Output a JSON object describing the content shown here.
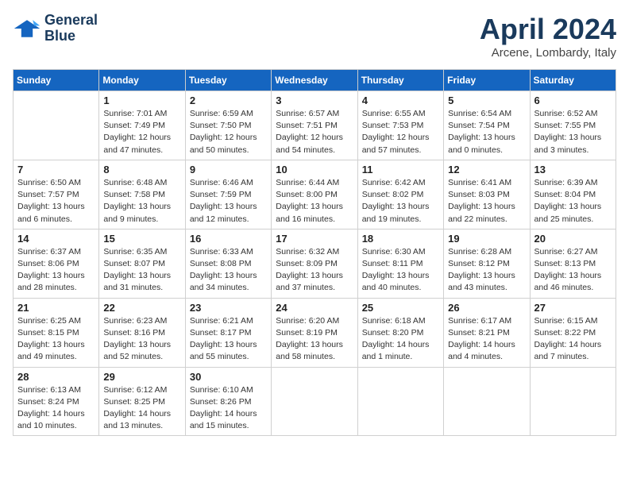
{
  "logo": {
    "line1": "General",
    "line2": "Blue"
  },
  "title": "April 2024",
  "location": "Arcene, Lombardy, Italy",
  "days_header": [
    "Sunday",
    "Monday",
    "Tuesday",
    "Wednesday",
    "Thursday",
    "Friday",
    "Saturday"
  ],
  "weeks": [
    [
      {
        "day": "",
        "info": ""
      },
      {
        "day": "1",
        "info": "Sunrise: 7:01 AM\nSunset: 7:49 PM\nDaylight: 12 hours\nand 47 minutes."
      },
      {
        "day": "2",
        "info": "Sunrise: 6:59 AM\nSunset: 7:50 PM\nDaylight: 12 hours\nand 50 minutes."
      },
      {
        "day": "3",
        "info": "Sunrise: 6:57 AM\nSunset: 7:51 PM\nDaylight: 12 hours\nand 54 minutes."
      },
      {
        "day": "4",
        "info": "Sunrise: 6:55 AM\nSunset: 7:53 PM\nDaylight: 12 hours\nand 57 minutes."
      },
      {
        "day": "5",
        "info": "Sunrise: 6:54 AM\nSunset: 7:54 PM\nDaylight: 13 hours\nand 0 minutes."
      },
      {
        "day": "6",
        "info": "Sunrise: 6:52 AM\nSunset: 7:55 PM\nDaylight: 13 hours\nand 3 minutes."
      }
    ],
    [
      {
        "day": "7",
        "info": "Sunrise: 6:50 AM\nSunset: 7:57 PM\nDaylight: 13 hours\nand 6 minutes."
      },
      {
        "day": "8",
        "info": "Sunrise: 6:48 AM\nSunset: 7:58 PM\nDaylight: 13 hours\nand 9 minutes."
      },
      {
        "day": "9",
        "info": "Sunrise: 6:46 AM\nSunset: 7:59 PM\nDaylight: 13 hours\nand 12 minutes."
      },
      {
        "day": "10",
        "info": "Sunrise: 6:44 AM\nSunset: 8:00 PM\nDaylight: 13 hours\nand 16 minutes."
      },
      {
        "day": "11",
        "info": "Sunrise: 6:42 AM\nSunset: 8:02 PM\nDaylight: 13 hours\nand 19 minutes."
      },
      {
        "day": "12",
        "info": "Sunrise: 6:41 AM\nSunset: 8:03 PM\nDaylight: 13 hours\nand 22 minutes."
      },
      {
        "day": "13",
        "info": "Sunrise: 6:39 AM\nSunset: 8:04 PM\nDaylight: 13 hours\nand 25 minutes."
      }
    ],
    [
      {
        "day": "14",
        "info": "Sunrise: 6:37 AM\nSunset: 8:06 PM\nDaylight: 13 hours\nand 28 minutes."
      },
      {
        "day": "15",
        "info": "Sunrise: 6:35 AM\nSunset: 8:07 PM\nDaylight: 13 hours\nand 31 minutes."
      },
      {
        "day": "16",
        "info": "Sunrise: 6:33 AM\nSunset: 8:08 PM\nDaylight: 13 hours\nand 34 minutes."
      },
      {
        "day": "17",
        "info": "Sunrise: 6:32 AM\nSunset: 8:09 PM\nDaylight: 13 hours\nand 37 minutes."
      },
      {
        "day": "18",
        "info": "Sunrise: 6:30 AM\nSunset: 8:11 PM\nDaylight: 13 hours\nand 40 minutes."
      },
      {
        "day": "19",
        "info": "Sunrise: 6:28 AM\nSunset: 8:12 PM\nDaylight: 13 hours\nand 43 minutes."
      },
      {
        "day": "20",
        "info": "Sunrise: 6:27 AM\nSunset: 8:13 PM\nDaylight: 13 hours\nand 46 minutes."
      }
    ],
    [
      {
        "day": "21",
        "info": "Sunrise: 6:25 AM\nSunset: 8:15 PM\nDaylight: 13 hours\nand 49 minutes."
      },
      {
        "day": "22",
        "info": "Sunrise: 6:23 AM\nSunset: 8:16 PM\nDaylight: 13 hours\nand 52 minutes."
      },
      {
        "day": "23",
        "info": "Sunrise: 6:21 AM\nSunset: 8:17 PM\nDaylight: 13 hours\nand 55 minutes."
      },
      {
        "day": "24",
        "info": "Sunrise: 6:20 AM\nSunset: 8:19 PM\nDaylight: 13 hours\nand 58 minutes."
      },
      {
        "day": "25",
        "info": "Sunrise: 6:18 AM\nSunset: 8:20 PM\nDaylight: 14 hours\nand 1 minute."
      },
      {
        "day": "26",
        "info": "Sunrise: 6:17 AM\nSunset: 8:21 PM\nDaylight: 14 hours\nand 4 minutes."
      },
      {
        "day": "27",
        "info": "Sunrise: 6:15 AM\nSunset: 8:22 PM\nDaylight: 14 hours\nand 7 minutes."
      }
    ],
    [
      {
        "day": "28",
        "info": "Sunrise: 6:13 AM\nSunset: 8:24 PM\nDaylight: 14 hours\nand 10 minutes."
      },
      {
        "day": "29",
        "info": "Sunrise: 6:12 AM\nSunset: 8:25 PM\nDaylight: 14 hours\nand 13 minutes."
      },
      {
        "day": "30",
        "info": "Sunrise: 6:10 AM\nSunset: 8:26 PM\nDaylight: 14 hours\nand 15 minutes."
      },
      {
        "day": "",
        "info": ""
      },
      {
        "day": "",
        "info": ""
      },
      {
        "day": "",
        "info": ""
      },
      {
        "day": "",
        "info": ""
      }
    ]
  ]
}
